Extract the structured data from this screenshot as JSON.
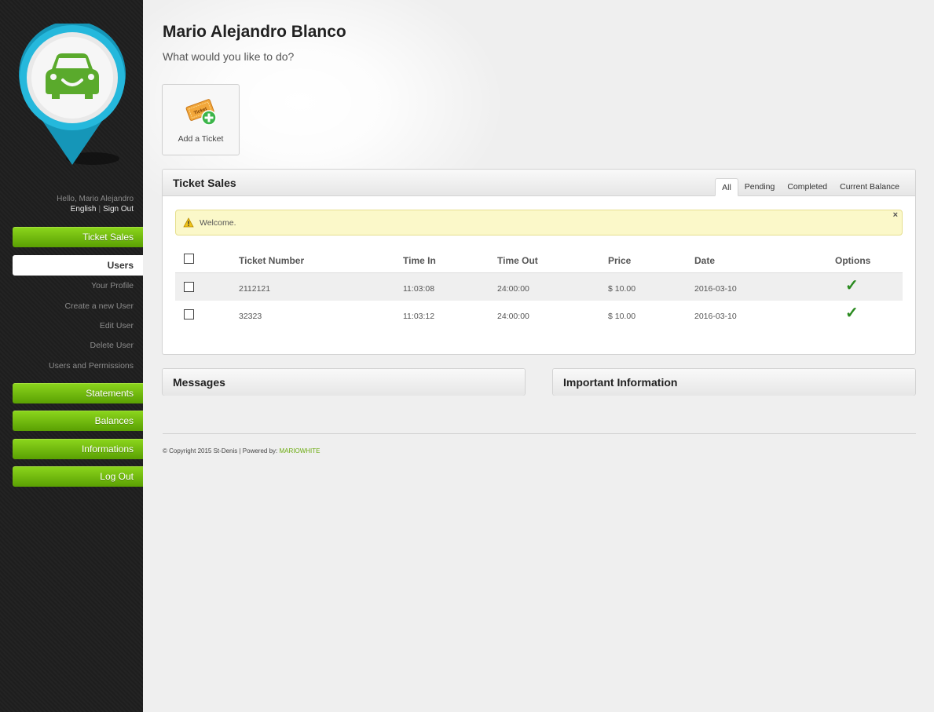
{
  "user": {
    "greeting": "Hello, Mario Alejandro",
    "language_link": "English",
    "separator": "|",
    "signout_link": "Sign Out"
  },
  "nav": {
    "ticket_sales": "Ticket Sales",
    "users": "Users",
    "sub_items": [
      "Your Profile",
      "Create a new User",
      "Edit User",
      "Delete User",
      "Users and Permissions"
    ],
    "statements": "Statements",
    "balances": "Balances",
    "informations": "Informations",
    "logout": "Log Out"
  },
  "main": {
    "title": "Mario Alejandro Blanco",
    "subtitle": "What would you like to do?",
    "actions": [
      {
        "label": "Add a Ticket",
        "icon": "add-ticket-icon",
        "icon_text": "Ticket"
      }
    ]
  },
  "ticket_panel": {
    "title": "Ticket Sales",
    "tabs": [
      "All",
      "Pending",
      "Completed",
      "Current Balance"
    ],
    "active_tab": "All",
    "alert": {
      "message": "Welcome.",
      "close": "×"
    },
    "columns": [
      "Ticket Number",
      "Time In",
      "Time Out",
      "Price",
      "Date",
      "Options"
    ],
    "rows": [
      {
        "ticket_number": "2112121",
        "time_in": "11:03:08",
        "time_out": "24:00:00",
        "price": "$ 10.00",
        "date": "2016-03-10",
        "option": "✓"
      },
      {
        "ticket_number": "32323",
        "time_in": "11:03:12",
        "time_out": "24:00:00",
        "price": "$ 10.00",
        "date": "2016-03-10",
        "option": "✓"
      }
    ]
  },
  "messages_panel": {
    "title": "Messages"
  },
  "info_panel": {
    "title": "Important Information"
  },
  "footer": {
    "text": "© Copyright 2015 St-Denis | Powered by:",
    "brand": "MARIOWHITE"
  },
  "colors": {
    "accent_green": "#6aaa0e",
    "sidebar_bg": "#222222",
    "logo_teal": "#19a7c9",
    "alert_bg": "#fbf8c9"
  }
}
